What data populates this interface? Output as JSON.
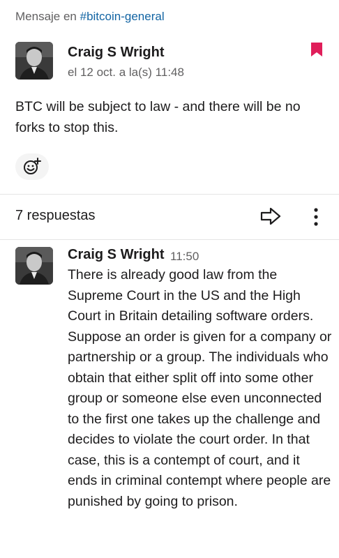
{
  "context": {
    "prefix": "Mensaje en ",
    "channel": "#bitcoin-general"
  },
  "message": {
    "author": "Craig S Wright",
    "date": "el 12 oct. a la(s) 11:48",
    "text": "BTC will be subject to law - and there will be no forks to stop this.",
    "bookmark_icon": "bookmark-icon",
    "bookmark_color": "#e01e5a"
  },
  "reaction": {
    "icon": "add-reaction-icon"
  },
  "thread": {
    "replies_label": "7 respuestas",
    "forward_icon": "forward-arrow-icon",
    "more_icon": "more-vertical-icon"
  },
  "reply": {
    "author": "Craig S Wright",
    "time": "11:50",
    "text": "There is already good law from the Supreme Court in the US and the High Court in Britain detailing software orders. Suppose an order is given for a company or partnership or a group. The individuals who obtain that either split off into some other group or someone else even unconnected to the first one takes up the challenge and decides to violate the court order. In that case, this is a contempt of court, and it ends in criminal contempt where people are punished by going to prison."
  }
}
